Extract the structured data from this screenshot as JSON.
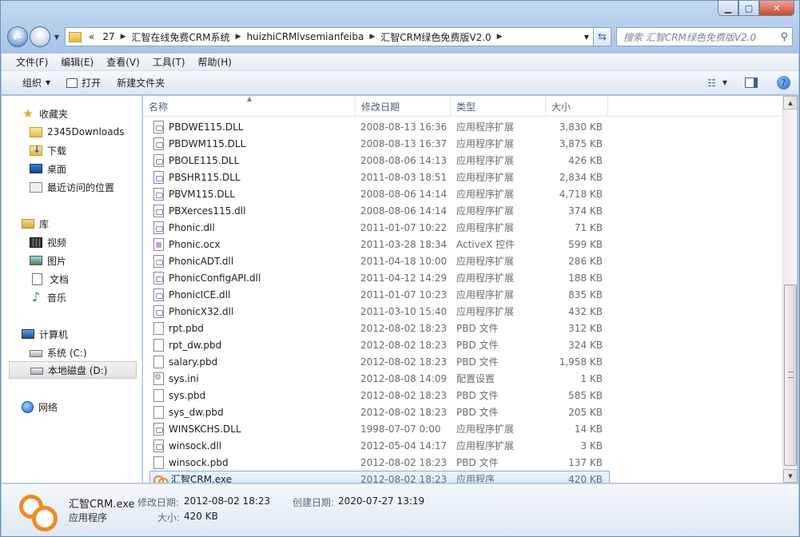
{
  "window": {
    "caption": {
      "minimize": "▁",
      "maximize": "▢",
      "close": "✕"
    }
  },
  "address": {
    "segments": [
      "«",
      "27",
      "汇智在线免费CRM系统",
      "huizhiCRMlvsemianfeiba",
      "汇智CRM绿色免费版V2.0"
    ],
    "search_placeholder": "搜索 汇智CRM绿色免费版V2.0"
  },
  "menubar": [
    "文件(F)",
    "编辑(E)",
    "查看(V)",
    "工具(T)",
    "帮助(H)"
  ],
  "toolbar": {
    "organize": "组织",
    "open": "打开",
    "new_folder": "新建文件夹"
  },
  "nav": {
    "favorites": "收藏夹",
    "favorites_items": [
      "2345Downloads",
      "下载",
      "桌面",
      "最近访问的位置"
    ],
    "library": "库",
    "library_items": [
      "视频",
      "图片",
      "文档",
      "音乐"
    ],
    "computer": "计算机",
    "computer_items": [
      "系统 (C:)",
      "本地磁盘 (D:)"
    ],
    "network": "网络"
  },
  "columns": [
    "名称",
    "修改日期",
    "类型",
    "大小"
  ],
  "files": [
    {
      "name": "PBDWE115.DLL",
      "date": "2008-08-13 16:36",
      "type": "应用程序扩展",
      "size": "3,830 KB",
      "icon": "dll"
    },
    {
      "name": "PBDWM115.DLL",
      "date": "2008-08-13 16:37",
      "type": "应用程序扩展",
      "size": "3,875 KB",
      "icon": "dll"
    },
    {
      "name": "PBOLE115.DLL",
      "date": "2008-08-06 14:13",
      "type": "应用程序扩展",
      "size": "426 KB",
      "icon": "dll"
    },
    {
      "name": "PBSHR115.DLL",
      "date": "2011-08-03 18:51",
      "type": "应用程序扩展",
      "size": "2,834 KB",
      "icon": "dll"
    },
    {
      "name": "PBVM115.DLL",
      "date": "2008-08-06 14:14",
      "type": "应用程序扩展",
      "size": "4,718 KB",
      "icon": "dll"
    },
    {
      "name": "PBXerces115.dll",
      "date": "2008-08-06 14:14",
      "type": "应用程序扩展",
      "size": "374 KB",
      "icon": "dll"
    },
    {
      "name": "Phonic.dll",
      "date": "2011-01-07 10:22",
      "type": "应用程序扩展",
      "size": "71 KB",
      "icon": "dll"
    },
    {
      "name": "Phonic.ocx",
      "date": "2011-03-28 18:34",
      "type": "ActiveX 控件",
      "size": "599 KB",
      "icon": "ocx"
    },
    {
      "name": "PhonicADT.dll",
      "date": "2011-04-18 10:00",
      "type": "应用程序扩展",
      "size": "286 KB",
      "icon": "dll"
    },
    {
      "name": "PhonicConfigAPI.dll",
      "date": "2011-04-12 14:29",
      "type": "应用程序扩展",
      "size": "188 KB",
      "icon": "dll"
    },
    {
      "name": "PhonicICE.dll",
      "date": "2011-01-07 10:23",
      "type": "应用程序扩展",
      "size": "835 KB",
      "icon": "dll"
    },
    {
      "name": "PhonicX32.dll",
      "date": "2011-03-10 15:40",
      "type": "应用程序扩展",
      "size": "432 KB",
      "icon": "dll"
    },
    {
      "name": "rpt.pbd",
      "date": "2012-08-02 18:23",
      "type": "PBD 文件",
      "size": "312 KB",
      "icon": "pbd"
    },
    {
      "name": "rpt_dw.pbd",
      "date": "2012-08-02 18:23",
      "type": "PBD 文件",
      "size": "324 KB",
      "icon": "pbd"
    },
    {
      "name": "salary.pbd",
      "date": "2012-08-02 18:23",
      "type": "PBD 文件",
      "size": "1,958 KB",
      "icon": "pbd"
    },
    {
      "name": "sys.ini",
      "date": "2012-08-08 14:09",
      "type": "配置设置",
      "size": "1 KB",
      "icon": "ini"
    },
    {
      "name": "sys.pbd",
      "date": "2012-08-02 18:23",
      "type": "PBD 文件",
      "size": "585 KB",
      "icon": "pbd"
    },
    {
      "name": "sys_dw.pbd",
      "date": "2012-08-02 18:23",
      "type": "PBD 文件",
      "size": "205 KB",
      "icon": "pbd"
    },
    {
      "name": "WINSKCHS.DLL",
      "date": "1998-07-07 0:00",
      "type": "应用程序扩展",
      "size": "14 KB",
      "icon": "dll"
    },
    {
      "name": "winsock.dll",
      "date": "2012-05-04 14:17",
      "type": "应用程序扩展",
      "size": "3 KB",
      "icon": "dll"
    },
    {
      "name": "winsock.pbd",
      "date": "2012-08-02 18:23",
      "type": "PBD 文件",
      "size": "137 KB",
      "icon": "pbd"
    },
    {
      "name": "汇智CRM.exe",
      "date": "2012-08-02 18:23",
      "type": "应用程序",
      "size": "420 KB",
      "icon": "exe",
      "selected": true
    }
  ],
  "details": {
    "name": "汇智CRM.exe",
    "type": "应用程序",
    "modified_label": "修改日期:",
    "modified": "2012-08-02 18:23",
    "created_label": "创建日期:",
    "created": "2020-07-27 13:19",
    "size_label": "大小:",
    "size": "420 KB"
  },
  "colors": {
    "selection_bg": "#d3e7fc",
    "selection_border": "#84acdd",
    "accent": "#f08a24"
  }
}
